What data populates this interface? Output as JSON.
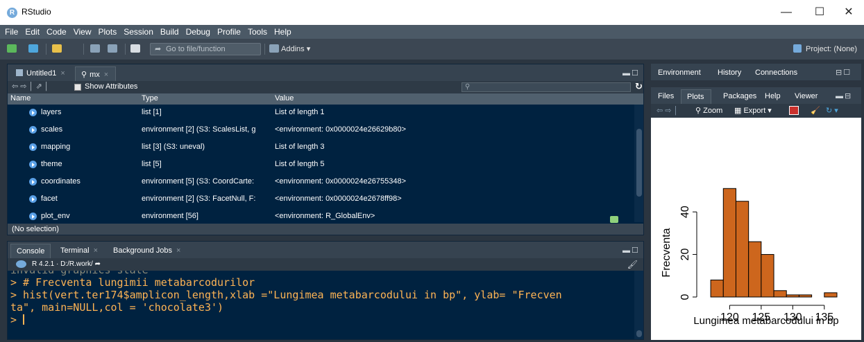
{
  "window": {
    "title": "RStudio",
    "minimize": "—",
    "maximize": "☐",
    "close": "✕"
  },
  "menu": [
    "File",
    "Edit",
    "Code",
    "View",
    "Plots",
    "Session",
    "Build",
    "Debug",
    "Profile",
    "Tools",
    "Help"
  ],
  "toolbar": {
    "goto_placeholder": "Go to file/function",
    "addins": "Addins ▾",
    "project": "Project: (None)"
  },
  "left_top": {
    "tabs": [
      {
        "label": "Untitled1"
      },
      {
        "label": "mx"
      }
    ],
    "show_attributes": "Show Attributes",
    "headers": {
      "name": "Name",
      "type": "Type",
      "value": "Value"
    },
    "rows": [
      {
        "name": "layers",
        "type": "list [1]",
        "value": "List of length 1"
      },
      {
        "name": "scales",
        "type": "environment [2] (S3: ScalesList, g",
        "value": "<environment: 0x0000024e26629b80>"
      },
      {
        "name": "mapping",
        "type": "list [3] (S3: uneval)",
        "value": "List of length 3"
      },
      {
        "name": "theme",
        "type": "list [5]",
        "value": "List of length 5"
      },
      {
        "name": "coordinates",
        "type": "environment [5] (S3: CoordCarte:",
        "value": "<environment: 0x0000024e26755348>"
      },
      {
        "name": "facet",
        "type": "environment [2] (S3: FacetNull, F:",
        "value": "<environment: 0x0000024e2678ff98>"
      },
      {
        "name": "plot_env",
        "type": "environment [56]",
        "value": "<environment: R_GlobalEnv>"
      }
    ],
    "status": "(No selection)"
  },
  "console": {
    "tabs": [
      {
        "label": "Console"
      },
      {
        "label": "Terminal"
      },
      {
        "label": "Background Jobs"
      }
    ],
    "version": "R 4.2.1",
    "path": "D:/R.work/",
    "lines": [
      "invalid graphics state",
      "> # Frecventa lungimii metabarcodurilor",
      "> hist(vert.ter174$amplicon_length,xlab =\"Lungimea metabarcodului in bp\", ylab= \"Frecven",
      "ta\", main=NULL,col = 'chocolate3')",
      "> "
    ]
  },
  "right_top": {
    "tabs": [
      "Environment",
      "History",
      "Connections"
    ]
  },
  "right_bottom": {
    "tabs": [
      "Files",
      "Plots",
      "Packages",
      "Help",
      "Viewer"
    ],
    "zoom": "Zoom",
    "export": "Export ▾"
  },
  "chart_data": {
    "type": "bar",
    "xlabel": "Lungimea metabarcodului in bp",
    "ylabel": "Frecventa",
    "bin_edges": [
      117,
      118,
      119,
      120,
      121,
      122,
      123,
      124,
      125,
      126,
      127,
      128,
      129,
      130,
      131,
      132,
      133,
      134,
      135
    ],
    "counts": [
      0,
      8,
      51,
      45,
      26,
      20,
      3,
      2,
      2,
      0,
      2
    ],
    "bars": [
      {
        "x0": 117,
        "x1": 119,
        "count": 8
      },
      {
        "x0": 119,
        "x1": 121,
        "count": 51
      },
      {
        "x0": 121,
        "x1": 123,
        "count": 45
      },
      {
        "x0": 123,
        "x1": 125,
        "count": 26
      },
      {
        "x0": 125,
        "x1": 127,
        "count": 20
      },
      {
        "x0": 127,
        "x1": 129,
        "count": 3
      },
      {
        "x0": 129,
        "x1": 131,
        "count": 1
      },
      {
        "x0": 131,
        "x1": 133,
        "count": 1
      },
      {
        "x0": 133,
        "x1": 135,
        "count": 0
      },
      {
        "x0": 135,
        "x1": 137,
        "count": 2
      }
    ],
    "xticks": [
      120,
      125,
      130,
      135
    ],
    "yticks": [
      0,
      20,
      40
    ],
    "xlim": [
      116,
      137
    ],
    "ylim": [
      0,
      55
    ],
    "fill": "#cd661d"
  }
}
